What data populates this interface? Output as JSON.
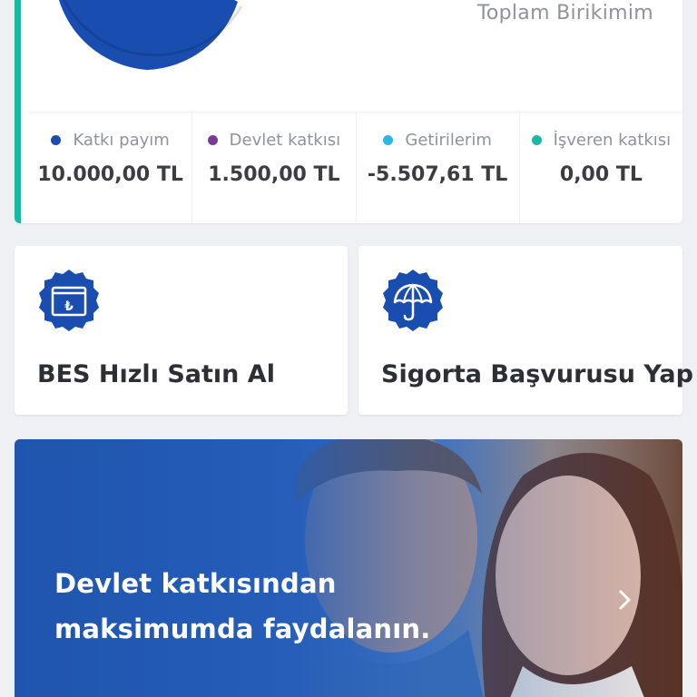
{
  "colors": {
    "accent_teal": "#1bb8a4",
    "contribution_blue": "#1a4db0",
    "state_purple": "#7b3a9a",
    "returns_cyan": "#29b6e8",
    "employer_teal": "#1bb8a4",
    "badge_blue": "#1a4db0"
  },
  "summary": {
    "total_label": "Toplam Birikimim",
    "stats": [
      {
        "label": "Katkı payım",
        "value": "10.000,00 TL",
        "dot_color": "#1a4db0"
      },
      {
        "label": "Devlet katkısı",
        "value": "1.500,00 TL",
        "dot_color": "#7b3a9a"
      },
      {
        "label": "Getirilerim",
        "value": "-5.507,61 TL",
        "dot_color": "#29b6e8"
      },
      {
        "label": "İşveren katkısı",
        "value": "0,00 TL",
        "dot_color": "#1bb8a4"
      }
    ]
  },
  "actions": [
    {
      "label": "BES Hızlı Satın Al",
      "icon": "lira-box-icon"
    },
    {
      "label": "Sigorta Başvurusu Yap",
      "icon": "umbrella-icon"
    }
  ],
  "banner": {
    "line1": "Devlet katkısından",
    "line2": "maksimumda faydalanın.",
    "icon": "chevron-right-icon"
  }
}
